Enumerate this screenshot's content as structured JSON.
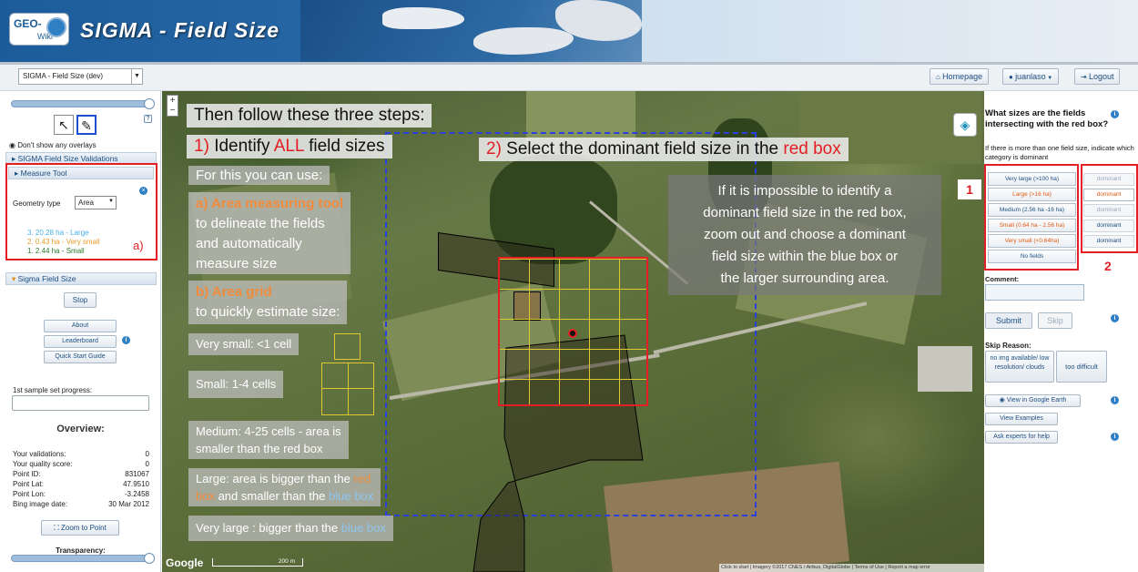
{
  "header": {
    "logo_top": "GEO-",
    "logo_bottom": "Wiki",
    "title": "SIGMA - Field Size"
  },
  "toolbar": {
    "project_select": "SIGMA - Field Size (dev)",
    "homepage": "Homepage",
    "user": "juanlaso",
    "logout": "Logout"
  },
  "left": {
    "show_overlays": "Don't show any overlays",
    "validations_header": "SIGMA Field Size Validations",
    "measure_header": "Measure Tool",
    "geometry_label": "Geometry type",
    "geometry_value": "Area",
    "measurements": [
      {
        "text": "3. 20.28 ha - Large",
        "color": "#4ab0e8"
      },
      {
        "text": "2. 0.43 ha - Very small",
        "color": "#e89b2a"
      },
      {
        "text": "1. 2.44 ha - Small",
        "color": "#2a7a2a"
      }
    ],
    "annot_a": "a)",
    "sigma_header": "Sigma Field Size",
    "stop": "Stop",
    "about": "About",
    "leaderboard": "Leaderboard",
    "quick_start": "Quick Start Guide",
    "progress_label": "1st sample set progress:",
    "overview_title": "Overview:",
    "overview": [
      {
        "label": "Your validations:",
        "value": "0"
      },
      {
        "label": "Your quality score:",
        "value": "0"
      },
      {
        "label": "Point ID:",
        "value": "831067"
      },
      {
        "label": "Point Lat:",
        "value": "47.9510"
      },
      {
        "label": "Point Lon:",
        "value": "-3.2458"
      },
      {
        "label": "Bing image date:",
        "value": "30 Mar 2012"
      }
    ],
    "zoom_to_point": "Zoom to Point",
    "transparency": "Transparency:"
  },
  "map": {
    "steps_title": "Then follow these three steps:",
    "step1_pre": "1) ",
    "step1_mid": "Identify ",
    "step1_all": "ALL",
    "step1_post": " field sizes",
    "step2_num": "2)",
    "step2_mid": " Select the dominant field size in the ",
    "step2_red": "red box",
    "use_label": "For this you can use:",
    "a_title": "a) Area measuring tool",
    "a_l1": "to delineate the fields",
    "a_l2": "and automatically",
    "a_l3": "measure size",
    "b_title": "b) Area grid",
    "b_l1": "to quickly estimate size:",
    "vs": "Very small: <1  cell",
    "sm": "Small: 1-4 cells",
    "med_l1": "Medium:  4-25 cells - area is",
    "med_l2": "smaller than the red box",
    "lg_l1a": "Large: area is bigger than the ",
    "lg_red": "red",
    "lg_l2a": "box",
    "lg_l2b": " and smaller than the ",
    "lg_blue": "blue box",
    "vl_a": "Very large : bigger than the ",
    "vl_blue": "blue box",
    "info_l1": "If it is impossible to identify a",
    "info_l2": "dominant field size in the red box,",
    "info_l3": "zoom out and choose a dominant",
    "info_l4": "field size within the blue box or",
    "info_l5": "the larger surrounding area.",
    "google": "Google",
    "scale": "200 m",
    "footer": "Click to start  | Imagery ©2017 CNES / Airbus, DigitalGlobe | Terms of Use | Report a map error"
  },
  "right": {
    "question": "What sizes are the fields intersecting with the red box?",
    "hint": "If there is more than one field size, indicate which category is dominant",
    "sizes": [
      "Very large (>100 ha)",
      "Large (>16 ha)",
      "Medium (2.56 ha -16 ha)",
      "Small (0.64 ha - 2.56 ha)",
      "Very small (<0.64ha)",
      "No fields"
    ],
    "size_colors": [
      "#1d4f82",
      "#e05a10",
      "#1d4f82",
      "#e05a10",
      "#e05a10",
      "#1d4f82"
    ],
    "dominant": [
      "dominant",
      "dominant",
      "dominant",
      "dominant",
      "dominant"
    ],
    "annot_1": "1",
    "annot_2": "2",
    "comment_label": "Comment:",
    "submit": "Submit",
    "skip": "Skip",
    "skip_reason": "Skip Reason:",
    "skip_opt1": "no img available/ low resolution/ clouds",
    "skip_opt2": "too difficult",
    "view_ge": "View in Google Earth",
    "view_examples": "View Examples",
    "ask_experts": "Ask experts for help"
  }
}
